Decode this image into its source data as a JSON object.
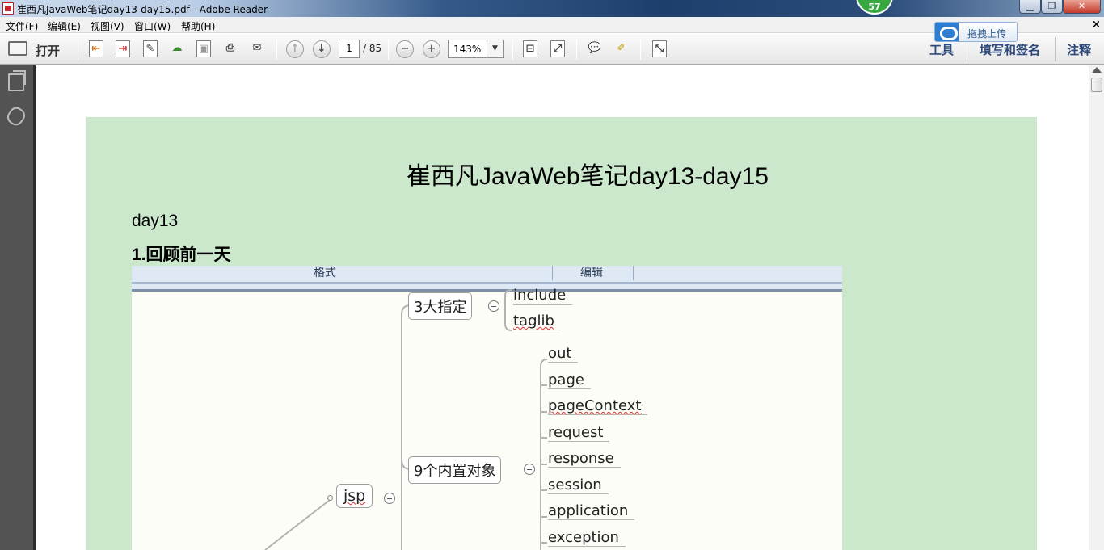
{
  "window": {
    "title": "崔西凡JavaWeb笔记day13-day15.pdf - Adobe Reader",
    "notification_count": "57"
  },
  "menu": {
    "items": [
      "文件(F)",
      "编辑(E)",
      "视图(V)",
      "窗口(W)",
      "帮助(H)"
    ]
  },
  "upload": {
    "label": "拖拽上传"
  },
  "toolbar": {
    "open_label": "打开",
    "page_current": "1",
    "page_total": "/ 85",
    "zoom": "143%",
    "right_tabs": [
      "工具",
      "填写和签名",
      "注释"
    ]
  },
  "document": {
    "title": "崔西凡JavaWeb笔记day13-day15",
    "day": "day13",
    "heading": "1.回顾前一天",
    "screenshot": {
      "ribbon_tabs": [
        "格式",
        "编辑"
      ],
      "root": "jsp",
      "groups": [
        {
          "label": "3大指定",
          "children": [
            "include",
            "taglib"
          ]
        },
        {
          "label": "9个内置对象",
          "children": [
            "out",
            "page",
            "pageContext",
            "request",
            "response",
            "session",
            "application",
            "exception"
          ]
        }
      ]
    }
  },
  "colors": {
    "page_background": "#cbe7cc",
    "nav_panel": "#535353",
    "tab_text": "#2e4a7a"
  }
}
